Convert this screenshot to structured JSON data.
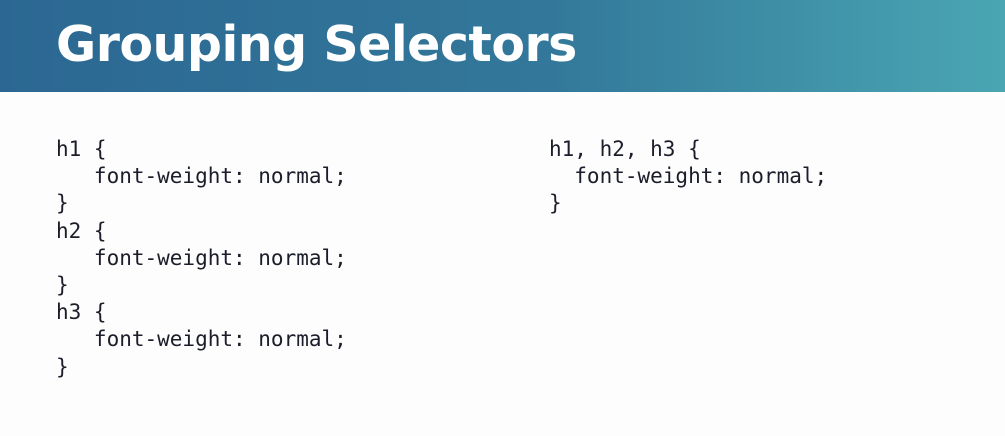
{
  "title": "Grouping Selectors",
  "code_left": {
    "lines": [
      "h1 {",
      "   font-weight: normal;",
      "}",
      "h2 {",
      "   font-weight: normal;",
      "}",
      "h3 {",
      "   font-weight: normal;",
      "}"
    ]
  },
  "code_right": {
    "lines": [
      "h1, h2, h3 {",
      "  font-weight: normal;",
      "}"
    ]
  },
  "colors": {
    "header_gradient_start": "#2b6792",
    "header_gradient_end": "#4aa6b3",
    "code_text": "#1b1d2a",
    "background": "#fdfdfd"
  }
}
